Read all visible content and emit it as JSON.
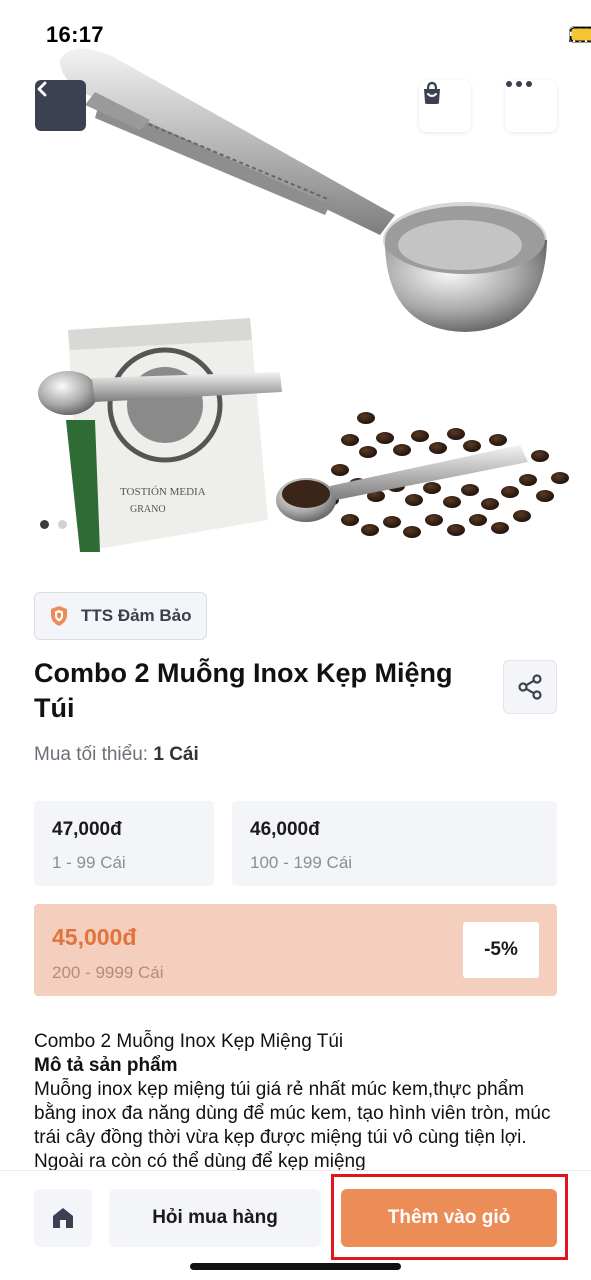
{
  "status": {
    "time": "16:17"
  },
  "header": {
    "back_icon": "chevron-left-icon",
    "cart_icon": "shopping-bag-icon",
    "more_icon": "more-horizontal-icon"
  },
  "carousel": {
    "count": 2,
    "active_index": 0
  },
  "guarantee": {
    "label": "TTS Đảm Bảo",
    "icon": "shield-icon"
  },
  "product": {
    "title": "Combo 2 Muỗng Inox Kẹp Miệng Túi",
    "min_order_label": "Mua tối thiểu:",
    "min_order_value": "1 Cái",
    "share_icon": "share-icon"
  },
  "price_tiers": [
    {
      "price": "47,000đ",
      "range": "1 - 99 Cái"
    },
    {
      "price": "46,000đ",
      "range": "100 - 199 Cái"
    },
    {
      "price": "45,000đ",
      "range": "200 - 9999 Cái",
      "discount": "-5%"
    }
  ],
  "description": {
    "line1": "Combo 2 Muỗng Inox Kẹp Miệng Túi",
    "heading": "Mô tả sản phẩm",
    "body": "Muỗng inox kẹp miệng túi giá rẻ nhất múc kem,thực phẩm bằng inox đa năng dùng để múc kem, tạo hình viên tròn, múc trái cây đồng thời vừa kẹp được miệng túi vô cùng tiện lợi. Ngoài ra còn có thể dùng để kẹp miệng"
  },
  "bottom_bar": {
    "home_icon": "home-icon",
    "ask_label": "Hỏi mua hàng",
    "add_label": "Thêm vào giỏ"
  },
  "colors": {
    "accent": "#ec8c57",
    "discount_bg": "#f5cfbd",
    "discount_text": "#e0733e",
    "highlight": "#e0161b"
  }
}
